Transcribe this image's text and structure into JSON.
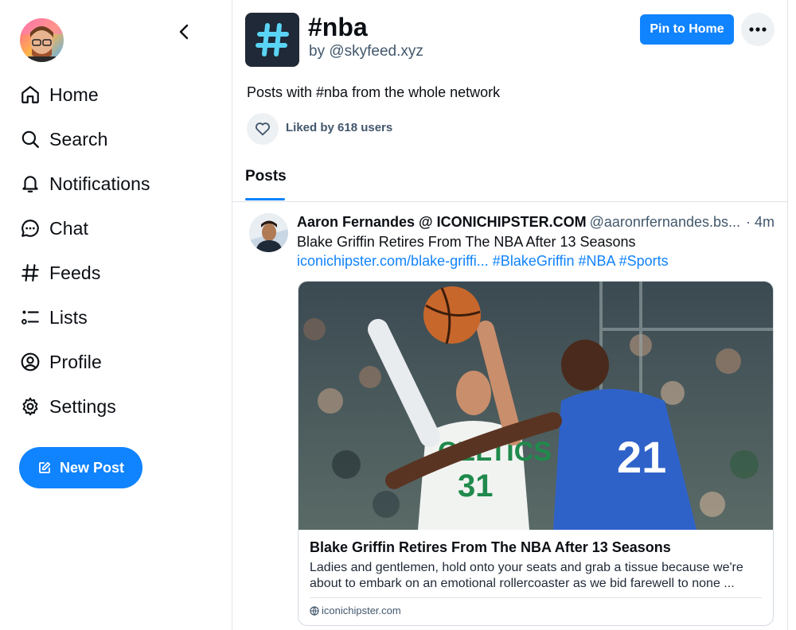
{
  "sidebar": {
    "nav": [
      {
        "label": "Home",
        "icon": "home-icon"
      },
      {
        "label": "Search",
        "icon": "search-icon"
      },
      {
        "label": "Notifications",
        "icon": "bell-icon"
      },
      {
        "label": "Chat",
        "icon": "chat-bubble-icon"
      },
      {
        "label": "Feeds",
        "icon": "hash-icon"
      },
      {
        "label": "Lists",
        "icon": "list-icon"
      },
      {
        "label": "Profile",
        "icon": "user-circle-icon"
      },
      {
        "label": "Settings",
        "icon": "gear-icon"
      }
    ],
    "new_post_label": "New Post"
  },
  "feed": {
    "title": "#nba",
    "by_prefix": "by",
    "creator_handle": "@skyfeed.xyz",
    "pin_label": "Pin to Home",
    "description": "Posts with #nba from the whole network",
    "liked_by": "Liked by 618 users",
    "tab_label": "Posts"
  },
  "post": {
    "author": "Aaron Fernandes @ ICONICHIPSTER.COM",
    "handle": "@aaronrfernandes.bs...",
    "time": "· 4m",
    "text": "Blake Griffin Retires From The NBA After 13 Seasons",
    "link": "iconichipster.com/blake-griffi...",
    "hashtags": [
      "#BlakeGriffin",
      "#NBA",
      "#Sports"
    ],
    "card": {
      "title": "Blake Griffin Retires From The NBA After 13 Seasons",
      "description": "Ladies and gentlemen, hold onto your seats and grab a tissue because we're about to embark on an emotional rollercoaster as we bid farewell to none ...",
      "domain": "iconichipster.com"
    }
  },
  "colors": {
    "accent": "#1083fe",
    "text": "#0b0f14",
    "muted": "#42576c",
    "border": "#dfe3e8"
  }
}
